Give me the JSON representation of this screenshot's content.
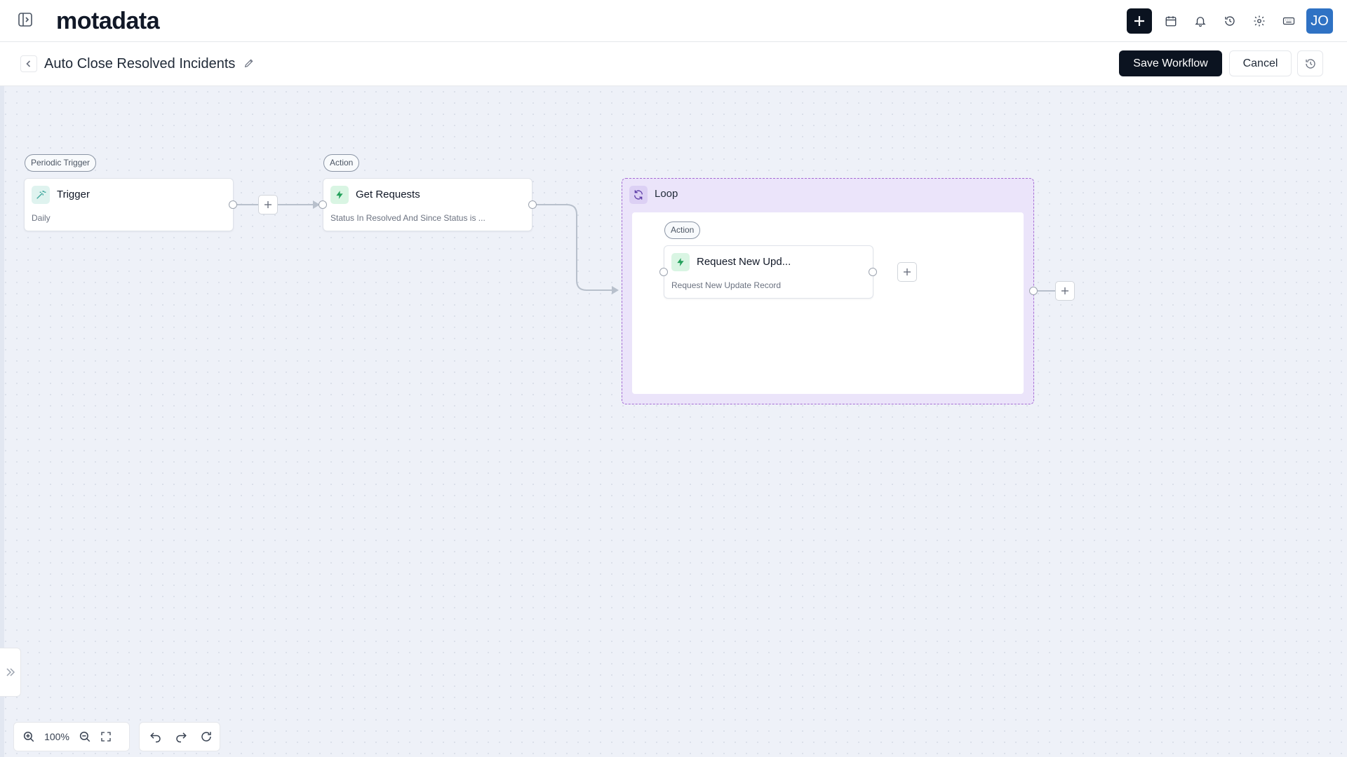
{
  "app": {
    "logo": "motadata"
  },
  "header": {
    "icons": [
      "sidebar-toggle-icon",
      "plus-icon",
      "calendar-icon",
      "bell-icon",
      "history-icon",
      "gear-icon",
      "keyboard-icon"
    ],
    "avatar_initials": "JO"
  },
  "workflow": {
    "title": "Auto Close Resolved Incidents",
    "save_label": "Save Workflow",
    "cancel_label": "Cancel"
  },
  "nodes": {
    "trigger": {
      "chip": "Periodic Trigger",
      "title": "Trigger",
      "subtitle": "Daily"
    },
    "get_requests": {
      "chip": "Action",
      "title": "Get Requests",
      "subtitle": "Status In Resolved And Since Status is ..."
    },
    "loop": {
      "label": "Loop"
    },
    "request_update": {
      "chip": "Action",
      "title": "Request New Upd...",
      "subtitle": "Request New Update Record"
    }
  },
  "controls": {
    "zoom_level": "100%"
  },
  "colors": {
    "primary_button": "#0b1320",
    "avatar": "#2f72c4",
    "canvas_bg": "#eef1f8",
    "loop_bg": "#ebe4fa",
    "loop_border": "#a56cd4",
    "action_icon_bg": "#d9f5e3",
    "action_icon": "#22a05a"
  }
}
